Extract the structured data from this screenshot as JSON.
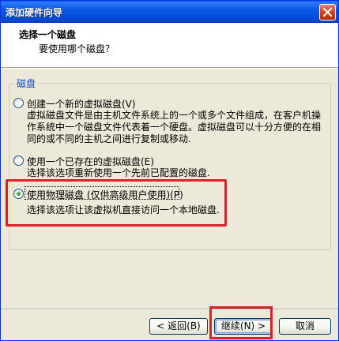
{
  "window": {
    "title": "添加硬件向导"
  },
  "header": {
    "title": "选择一个磁盘",
    "subtitle": "要使用哪个磁盘？"
  },
  "group": {
    "label": "磁盘"
  },
  "options": [
    {
      "label": "创建一个新的虚拟磁盘(V)",
      "description_lines": [
        "虚拟磁盘文件是由主机文件系统上的一个或多个文件组成，在客户机操",
        "作系统中一个磁盘文件代表着一个硬盘。虚拟磁盘可以十分方便的在相",
        "同的或不同的主机之间进行复制或移动."
      ],
      "selected": false
    },
    {
      "label": "使用一个已存在的虚拟磁盘(E)",
      "description_lines": [
        "选择该选项重新使用一个先前已配置的磁盘."
      ],
      "selected": false
    },
    {
      "label": "使用物理磁盘 (仅供高级用户使用)(P)",
      "description_lines": [
        "选择该选项让该虚拟机直接访问一个本地磁盘."
      ],
      "selected": true
    }
  ],
  "buttons": {
    "back": "< 返回(B)",
    "next": "继续(N) >",
    "cancel": "取消"
  },
  "colors": {
    "title_bar": "#0b58e6",
    "group_label": "#0046d5",
    "annotation_red": "#d8222a"
  }
}
